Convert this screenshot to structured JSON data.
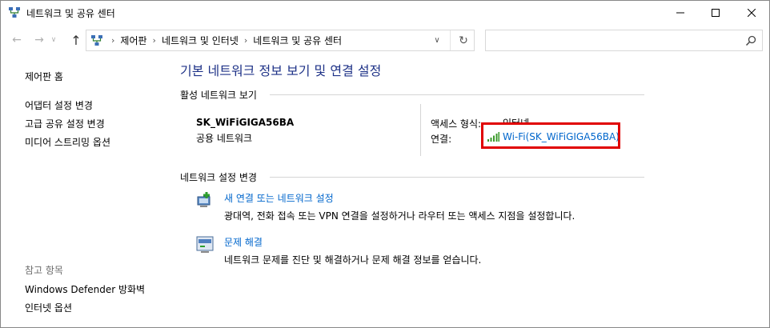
{
  "window": {
    "title": "네트워크 및 공유 센터",
    "controls": {
      "minimize": "—",
      "maximize": "☐",
      "close": "✕"
    }
  },
  "navigation": {
    "back": "←",
    "forward": "→",
    "recent": "∨",
    "up": "↑",
    "breadcrumbs": [
      "제어판",
      "네트워크 및 인터넷",
      "네트워크 및 공유 센터"
    ],
    "breadcrumb_separator": "›",
    "dropdown": "∨",
    "refresh": "↻",
    "search_placeholder": "",
    "search_value": ""
  },
  "sidebar": {
    "home": "제어판 홈",
    "links": [
      "어댑터 설정 변경",
      "고급 공유 설정 변경",
      "미디어 스트리밍 옵션"
    ],
    "see_also_label": "참고 항목",
    "see_also": [
      "Windows Defender 방화벽",
      "인터넷 옵션"
    ]
  },
  "main": {
    "title": "기본 네트워크 정보 보기 및 연결 설정",
    "active_networks_header": "활성 네트워크 보기",
    "network": {
      "name": "SK_WiFiGIGA56BA",
      "type": "공용 네트워크",
      "access_type_label": "액세스 형식:",
      "access_type_value": "인터넷",
      "connection_label": "연결:",
      "connection_value": "Wi-Fi(SK_WiFiGIGA56BA)"
    },
    "change_settings_header": "네트워크 설정 변경",
    "tasks": [
      {
        "icon": "new-connection-icon",
        "link": "새 연결 또는 네트워크 설정",
        "description": "광대역, 전화 접속 또는 VPN 연결을 설정하거나 라우터 또는 액세스 지점을 설정합니다."
      },
      {
        "icon": "troubleshoot-icon",
        "link": "문제 해결",
        "description": "네트워크 문제를 진단 및 해결하거나 문제 해결 정보를 얻습니다."
      }
    ]
  },
  "colors": {
    "title_blue": "#1e3287",
    "link_blue": "#0066cc",
    "highlight_red": "#e00000",
    "wifi_green": "#3a9a2a"
  }
}
